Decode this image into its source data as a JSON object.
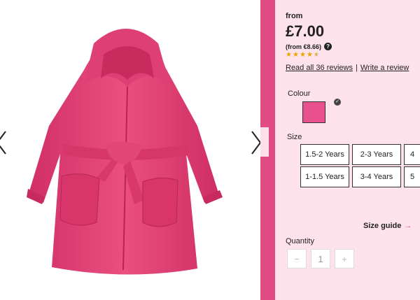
{
  "product": {
    "from_label": "from",
    "price": "£7.00",
    "price_eur": "(from €8.66)",
    "rating": 4.5,
    "rating_max": 5,
    "reviews_link": "Read all 36 reviews",
    "separator": "|",
    "write_review_link": "Write a review"
  },
  "colour": {
    "label": "Colour",
    "selected_hex": "#e8508e"
  },
  "size": {
    "label": "Size",
    "options": [
      "1.5-2 Years",
      "2-3 Years",
      "4",
      "1-1.5 Years",
      "3-4 Years",
      "5"
    ]
  },
  "size_guide": {
    "label": "Size guide",
    "arrow": "→"
  },
  "quantity": {
    "label": "Quantity",
    "minus": "−",
    "value": "1",
    "plus": "+"
  },
  "colors": {
    "accent": "#e24c84",
    "robe": "#e33f74",
    "panel": "#fde0ea"
  },
  "icons": {
    "prev": "chevron-left-icon",
    "next": "chevron-right-icon",
    "help": "question-icon",
    "check": "check-icon",
    "star": "star-icon"
  },
  "help_glyph": "?",
  "check_glyph": "✓"
}
